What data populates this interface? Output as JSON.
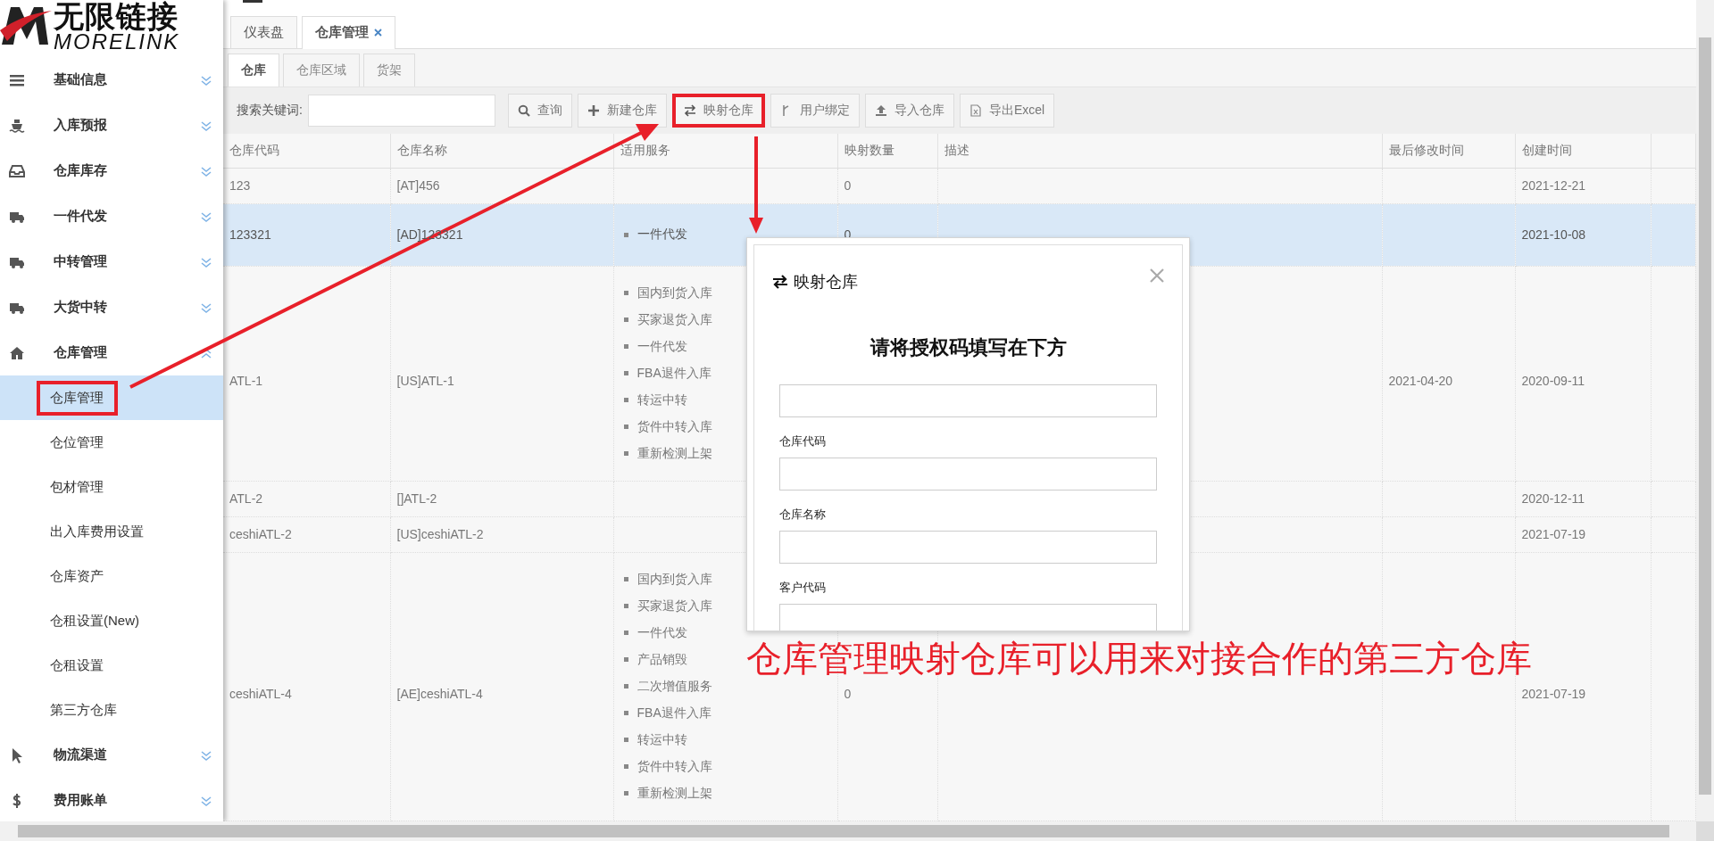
{
  "logo": {
    "cn": "无限链接",
    "en": "MORELINK"
  },
  "sidebar": {
    "items": [
      {
        "label": "基础信息",
        "expanded": false
      },
      {
        "label": "入库预报",
        "expanded": false
      },
      {
        "label": "仓库库存",
        "expanded": false
      },
      {
        "label": "一件代发",
        "expanded": false
      },
      {
        "label": "中转管理",
        "expanded": false
      },
      {
        "label": "大货中转",
        "expanded": false
      },
      {
        "label": "仓库管理",
        "expanded": true,
        "children": [
          {
            "label": "仓库管理",
            "selected": true,
            "highlighted": true
          },
          {
            "label": "仓位管理",
            "selected": false,
            "highlighted": false
          },
          {
            "label": "包材管理",
            "selected": false,
            "highlighted": false
          },
          {
            "label": "出入库费用设置",
            "selected": false,
            "highlighted": false
          },
          {
            "label": "仓库资产",
            "selected": false,
            "highlighted": false
          },
          {
            "label": "仓租设置(New)",
            "selected": false,
            "highlighted": false
          },
          {
            "label": "仓租设置",
            "selected": false,
            "highlighted": false
          },
          {
            "label": "第三方仓库",
            "selected": false,
            "highlighted": false
          }
        ]
      },
      {
        "label": "物流渠道",
        "expanded": false
      },
      {
        "label": "费用账单",
        "expanded": false
      }
    ]
  },
  "tabs": [
    {
      "label": "仪表盘",
      "selected": false,
      "closable": false
    },
    {
      "label": "仓库管理",
      "selected": true,
      "closable": true
    }
  ],
  "subtabs": [
    {
      "label": "仓库",
      "selected": true
    },
    {
      "label": "仓库区域",
      "selected": false
    },
    {
      "label": "货架",
      "selected": false
    }
  ],
  "toolbar": {
    "search_label": "搜索关键词:",
    "buttons": [
      {
        "label": "查询",
        "highlighted": false
      },
      {
        "label": "新建仓库",
        "highlighted": false
      },
      {
        "label": "映射仓库",
        "highlighted": true
      },
      {
        "label": "用户绑定",
        "highlighted": false
      },
      {
        "label": "导入仓库",
        "highlighted": false
      },
      {
        "label": "导出Excel",
        "highlighted": false
      }
    ]
  },
  "table": {
    "columns": [
      "仓库代码",
      "仓库名称",
      "适用服务",
      "映射数量",
      "描述",
      "最后修改时间",
      "创建时间"
    ],
    "rows": [
      {
        "code": "123",
        "name": "[AT]456",
        "services": [],
        "count": "0",
        "created": "2021-12-21",
        "selected": false
      },
      {
        "code": "123321",
        "name": "[AD]123321",
        "services": [
          "一件代发"
        ],
        "count": "0",
        "created": "2021-10-08",
        "selected": true
      },
      {
        "code": "ATL-1",
        "name": "[US]ATL-1",
        "services": [
          "国内到货入库",
          "买家退货入库",
          "一件代发",
          "FBA退件入库",
          "转运中转",
          "货件中转入库",
          "重新检测上架"
        ],
        "modified": "2021-04-20",
        "created": "2020-09-11",
        "selected": false
      },
      {
        "code": "ATL-2",
        "name": "[]ATL-2",
        "services": [],
        "created": "2020-12-11",
        "selected": false
      },
      {
        "code": "ceshiATL-2",
        "name": "[US]ceshiATL-2",
        "services": [],
        "created": "2021-07-19",
        "selected": false
      },
      {
        "code": "ceshiATL-4",
        "name": "[AE]ceshiATL-4",
        "services": [
          "国内到货入库",
          "买家退货入库",
          "一件代发",
          "产品销毁",
          "二次增值服务",
          "FBA退件入库",
          "转运中转",
          "货件中转入库",
          "重新检测上架"
        ],
        "count": "0",
        "created": "2021-07-19",
        "selected": false
      }
    ]
  },
  "dialog": {
    "title": "映射仓库",
    "heading": "请将授权码填写在下方",
    "auth_code_input": {
      "kind": "text"
    },
    "fields": [
      {
        "label": "仓库代码"
      },
      {
        "label": "仓库名称"
      },
      {
        "label": "客户代码"
      }
    ]
  },
  "annotation": {
    "text": "仓库管理映射仓库可以用来对接合作的第三方仓库"
  }
}
